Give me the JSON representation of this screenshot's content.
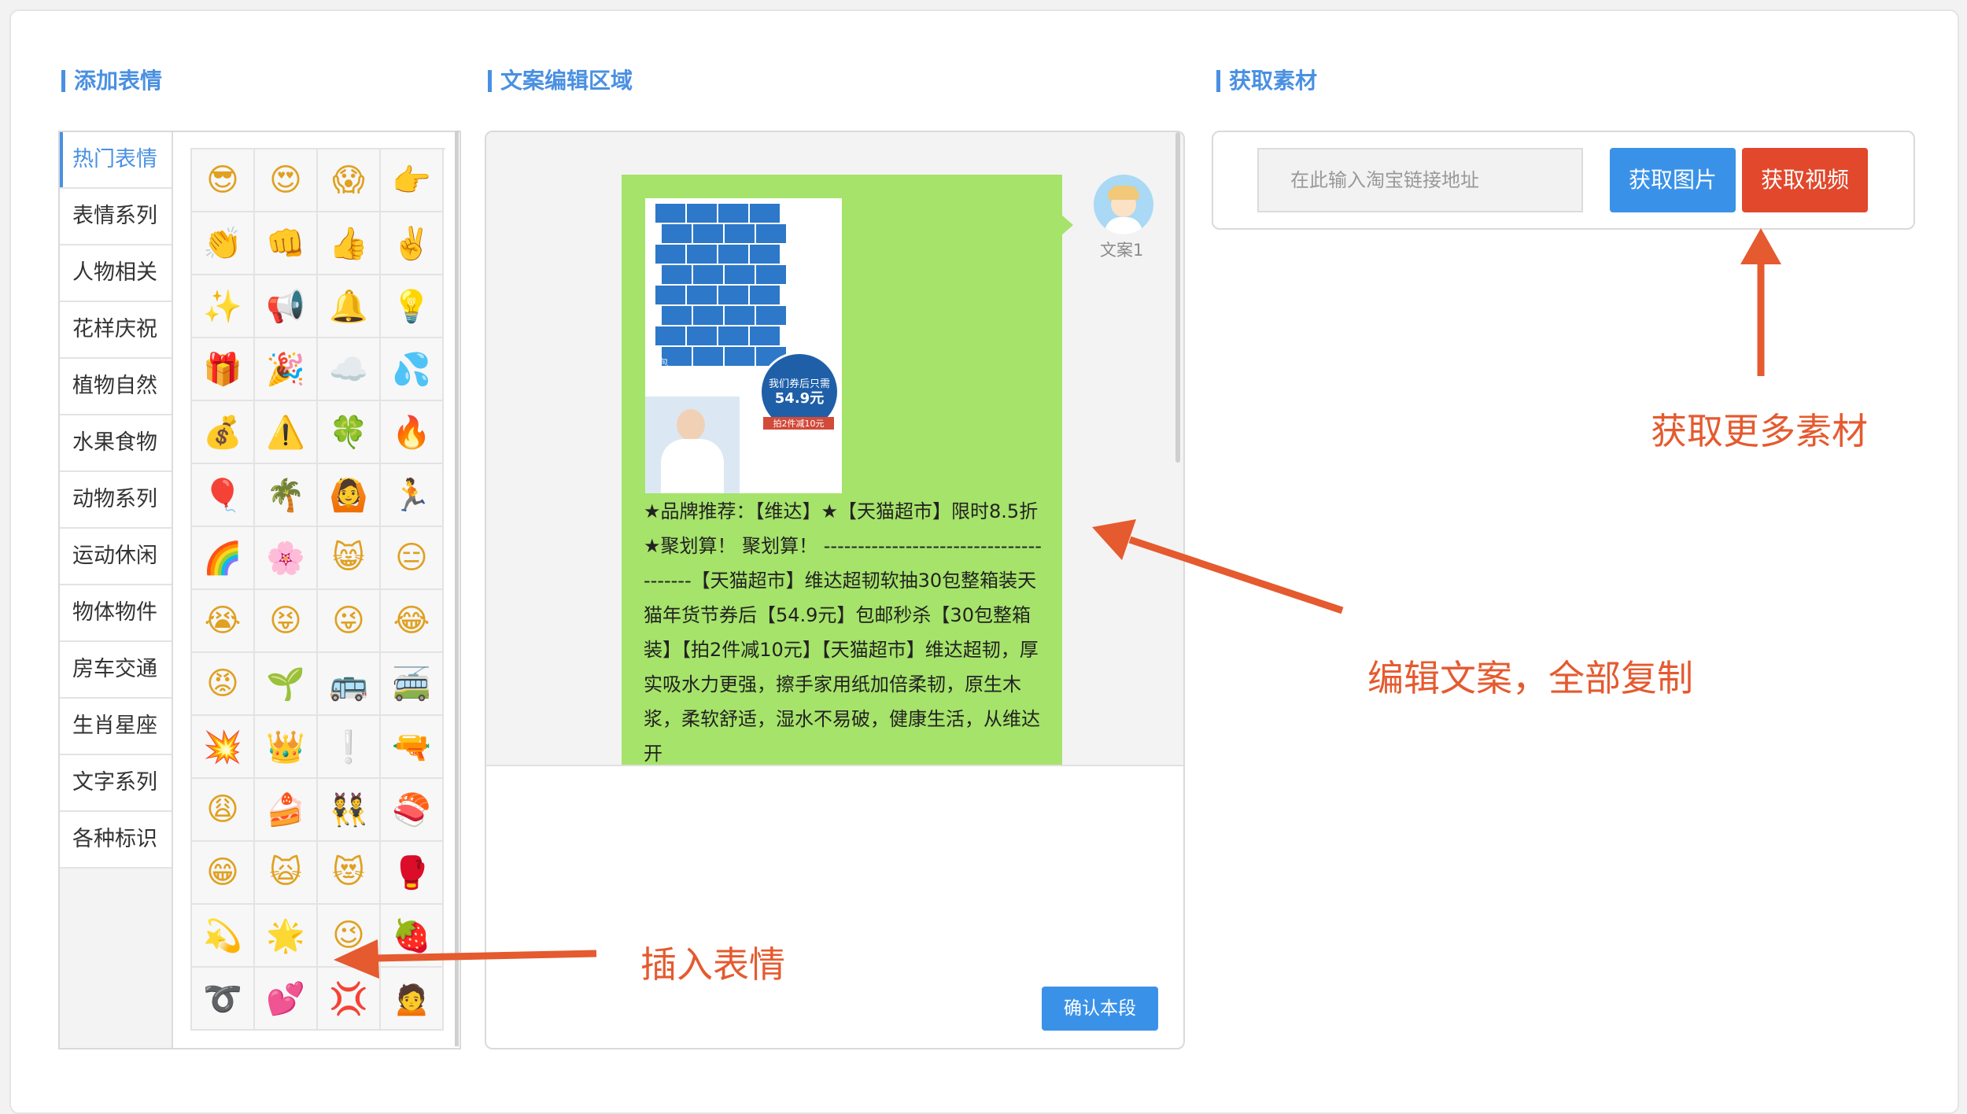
{
  "sections": {
    "emoji_title": "添加表情",
    "editor_title": "文案编辑区域",
    "material_title": "获取素材"
  },
  "emoji_categories": [
    {
      "label": "热门表情",
      "active": true
    },
    {
      "label": "表情系列"
    },
    {
      "label": "人物相关"
    },
    {
      "label": "花样庆祝"
    },
    {
      "label": "植物自然"
    },
    {
      "label": "水果食物"
    },
    {
      "label": "动物系列"
    },
    {
      "label": "运动休闲"
    },
    {
      "label": "物体物件"
    },
    {
      "label": "房车交通"
    },
    {
      "label": "生肖星座"
    },
    {
      "label": "文字系列"
    },
    {
      "label": "各种标识"
    }
  ],
  "emojis": [
    "😎",
    "😍",
    "😱",
    "👉",
    "👏",
    "👊",
    "👍",
    "✌️",
    "✨",
    "📢",
    "🔔",
    "💡",
    "🎁",
    "🎉",
    "☁️",
    "💦",
    "💰",
    "⚠️",
    "🍀",
    "🔥",
    "🎈",
    "🌴",
    "🙆",
    "🏃",
    "🌈",
    "🌸",
    "😸",
    "😑",
    "😭",
    "😝",
    "😜",
    "😂",
    "😡",
    "🌱",
    "🚌",
    "🚎",
    "💥",
    "👑",
    "❕",
    "🔫",
    "😩",
    "🍰",
    "👯",
    "🍣",
    "😁",
    "🙀",
    "😻",
    "🥊",
    "💫",
    "🌟",
    "😉",
    "🍓",
    "➰",
    "💕",
    "💢",
    "🙍"
  ],
  "editor": {
    "avatar_label": "文案1",
    "product_image": {
      "price_caption": "我们券后只需",
      "price": "54.9元",
      "promo": "拍2件减10元",
      "pack_label": "30包"
    },
    "copy_text": "★品牌推荐：【维达】★【天猫超市】限时8.5折★聚划算！ 聚划算！ ---------------------------------------【天猫超市】维达超韧软抽30包整箱装天猫年货节券后【54.9元】包邮秒杀【30包整箱装】【拍2件减10元】【天猫超市】维达超韧，厚实吸水力更强，擦手家用纸加倍柔韧，原生木浆，柔软舒适，湿水不易破，健康生活，从维达开",
    "confirm_button": "确认本段"
  },
  "material": {
    "input_placeholder": "在此输入淘宝链接地址",
    "get_image_button": "获取图片",
    "get_video_button": "获取视频"
  },
  "annotations": {
    "more_material": "获取更多素材",
    "edit_copy": "编辑文案，全部复制",
    "insert_emoji": "插入表情"
  },
  "colors": {
    "accent": "#4a90e2",
    "bubble": "#a6e36a",
    "video_button": "#e2482c",
    "annotation": "#e55a2f"
  }
}
